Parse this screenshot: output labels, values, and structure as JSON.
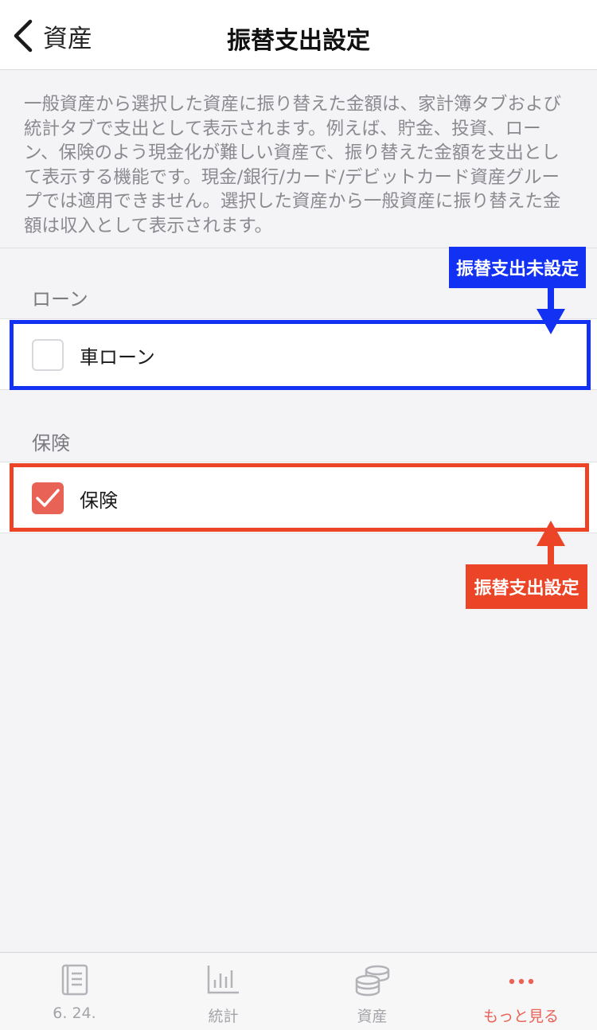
{
  "header": {
    "back_label": "資産",
    "title": "振替支出設定"
  },
  "description": [
    "一般資産から選択した資産に振り替えた金額は、家計簿タブおよび",
    "統計タブで支出として表示されます。例えば、貯金、投資、ロー",
    "ン、保険のよう現金化が難しい資産で、振り替えた金額を支出とし",
    "て表示する機能です。現金/銀行/カード/デビットカード資産グルー",
    "プでは適用できません。選択した資産から一般資産に振り替えた金",
    "額は収入として表示されます。"
  ],
  "sections": [
    {
      "label": "ローン",
      "items": [
        {
          "label": "車ローン",
          "checked": false
        }
      ]
    },
    {
      "label": "保険",
      "items": [
        {
          "label": "保険",
          "checked": true
        }
      ]
    }
  ],
  "annotations": {
    "unset_label": "振替支出未設定",
    "set_label": "振替支出設定",
    "blue": "#1231f2",
    "red": "#ec4427"
  },
  "tab_bar": {
    "tabs": [
      {
        "label": "6. 24.",
        "icon": "book-icon",
        "active": false
      },
      {
        "label": "統計",
        "icon": "bar-chart-icon",
        "active": false
      },
      {
        "label": "資産",
        "icon": "coins-icon",
        "active": false
      },
      {
        "label": "もっと見る",
        "icon": "more-dots-icon",
        "active": true
      }
    ]
  },
  "colors": {
    "accent": "#e86256",
    "background": "#f4f4f7"
  }
}
